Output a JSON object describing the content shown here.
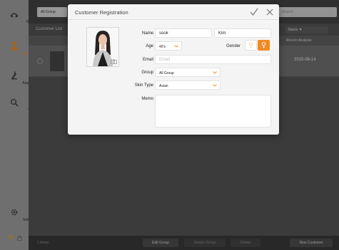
{
  "sidebar": {
    "items": [
      {
        "label": "Home",
        "icon": "home-logo-icon"
      },
      {
        "label": "Customer",
        "icon": "customer-icon"
      },
      {
        "label": "Analysis",
        "icon": "analysis-icon"
      },
      {
        "label": "View",
        "icon": "view-icon"
      },
      {
        "label": "Settings",
        "icon": "gear-icon"
      }
    ],
    "active_color": "#e98a2a"
  },
  "topbar": {
    "group_select": "All Group",
    "search_placeholder": "Search"
  },
  "list": {
    "title": "Customer List",
    "sort_label": "Name ▼",
    "recent_header": "Recent Analysis",
    "rows": [
      {
        "date": "2015-06-14"
      }
    ]
  },
  "bottombar": {
    "count": "1 Items",
    "edit_group": "Edit Group",
    "assign_group": "Assign Group",
    "delete": "Delete",
    "new_customer": "New Customer"
  },
  "modal": {
    "title": "Customer Registration",
    "labels": {
      "name": "Name",
      "age": "Age",
      "gender": "Gender",
      "email": "Email",
      "group": "Group",
      "skin_type": "Skin Type",
      "memo": "Memo"
    },
    "first_name": "sook",
    "last_name": "Kim",
    "age": "40's",
    "email_placeholder": "Email",
    "group": "All Group",
    "skin_type": "Asian",
    "gender_selected": "female",
    "accent_color": "#f08a24"
  }
}
